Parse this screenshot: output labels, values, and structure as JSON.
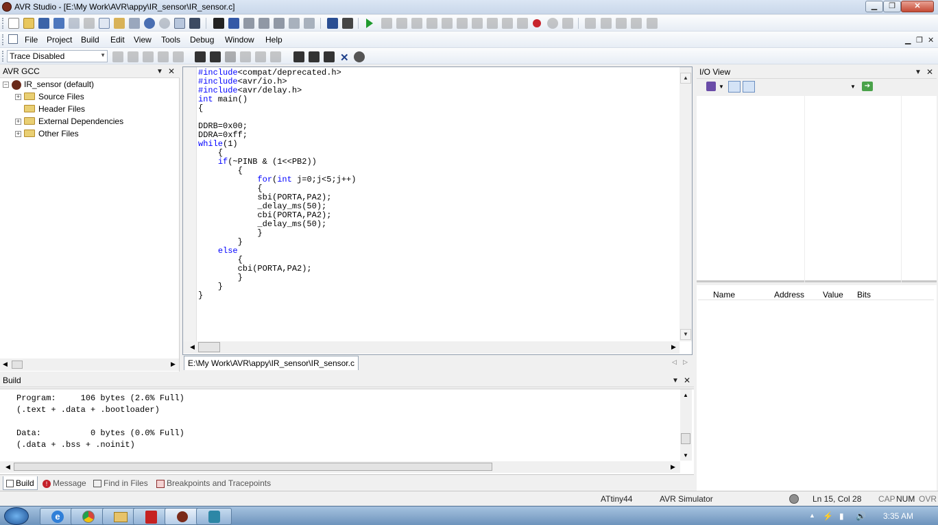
{
  "window": {
    "title": "AVR Studio - [E:\\My Work\\AVR\\appy\\IR_sensor\\IR_sensor.c]"
  },
  "menu": {
    "items": [
      "File",
      "Project",
      "Build",
      "Edit",
      "View",
      "Tools",
      "Debug",
      "Window",
      "Help"
    ]
  },
  "trace": {
    "value": "Trace Disabled"
  },
  "project_panel": {
    "title": "AVR GCC",
    "root": "IR_sensor (default)",
    "folders": [
      "Source Files",
      "Header Files",
      "External Dependencies",
      "Other Files"
    ]
  },
  "editor": {
    "lines": [
      "#include<compat/deprecated.h>",
      "#include<avr/io.h>",
      "#include<avr/delay.h>",
      "int main()",
      "{",
      "",
      "DDRB=0x00;",
      "DDRA=0xff;",
      "while(1)",
      "    {",
      "    if(~PINB & (1<<PB2))",
      "        {",
      "            for(int j=0;j<5;j++)",
      "            {",
      "            sbi(PORTA,PA2);",
      "            _delay_ms(50);",
      "            cbi(PORTA,PA2);",
      "            _delay_ms(50);",
      "            }",
      "        }",
      "    else",
      "        {",
      "        cbi(PORTA,PA2);",
      "        }",
      "    }",
      "}"
    ],
    "tab": "E:\\My Work\\AVR\\appy\\IR_sensor\\IR_sensor.c"
  },
  "build_panel": {
    "title": "Build",
    "lines": [
      "Program:     106 bytes (2.6% Full)",
      "(.text + .data + .bootloader)",
      "",
      "Data:          0 bytes (0.0% Full)",
      "(.data + .bss + .noinit)"
    ],
    "tabs": [
      "Build",
      "Message",
      "Find in Files",
      "Breakpoints and Tracepoints"
    ]
  },
  "io_view": {
    "title": "I/O View",
    "columns": [
      "Name",
      "Address",
      "Value",
      "Bits"
    ]
  },
  "status": {
    "device": "ATtiny44",
    "platform": "AVR Simulator",
    "position": "Ln 15, Col 28",
    "caps": "CAP",
    "num": "NUM",
    "ovr": "OVR"
  },
  "taskbar": {
    "time": "3:35 AM"
  },
  "colors": {
    "keyword": "#0000ff",
    "titlebar": "#c9d7ea",
    "taskbar": "#6d93bc"
  }
}
